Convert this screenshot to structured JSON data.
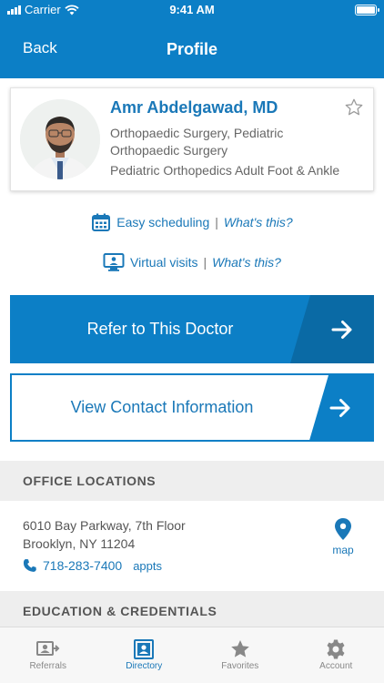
{
  "status_bar": {
    "carrier": "Carrier",
    "time": "9:41 AM"
  },
  "nav": {
    "back_label": "Back",
    "title": "Profile"
  },
  "doctor": {
    "name": "Amr Abdelgawad, MD",
    "specialty": "Orthopaedic Surgery, Pediatric Orthopaedic Surgery",
    "subspecialty": "Pediatric Orthopedics Adult Foot & Ankle",
    "favorite_icon": "star-outline-icon"
  },
  "features": [
    {
      "icon": "calendar-icon",
      "label": "Easy scheduling",
      "separator": "|",
      "help": "What's this?"
    },
    {
      "icon": "monitor-video-icon",
      "label": "Virtual visits",
      "separator": "|",
      "help": "What's this?"
    }
  ],
  "buttons": {
    "refer": "Refer to This Doctor",
    "contact": "View Contact Information"
  },
  "office": {
    "heading": "OFFICE LOCATIONS",
    "address_line1": "6010 Bay Parkway, 7th Floor",
    "address_line2": "Brooklyn, NY 11204",
    "phone": "718-283-7400",
    "appts": "appts",
    "map_label": "map"
  },
  "education": {
    "heading": "EDUCATION & CREDENTIALS"
  },
  "tabs": [
    {
      "label": "Referrals",
      "icon": "referrals-icon",
      "active": false
    },
    {
      "label": "Directory",
      "icon": "directory-icon",
      "active": true
    },
    {
      "label": "Favorites",
      "icon": "star-icon",
      "active": false
    },
    {
      "label": "Account",
      "icon": "gear-icon",
      "active": false
    }
  ],
  "colors": {
    "primary": "#0c7fc6",
    "primary_dark": "#0a6aa5",
    "link": "#1a78b8",
    "section_bg": "#eeeeee"
  }
}
